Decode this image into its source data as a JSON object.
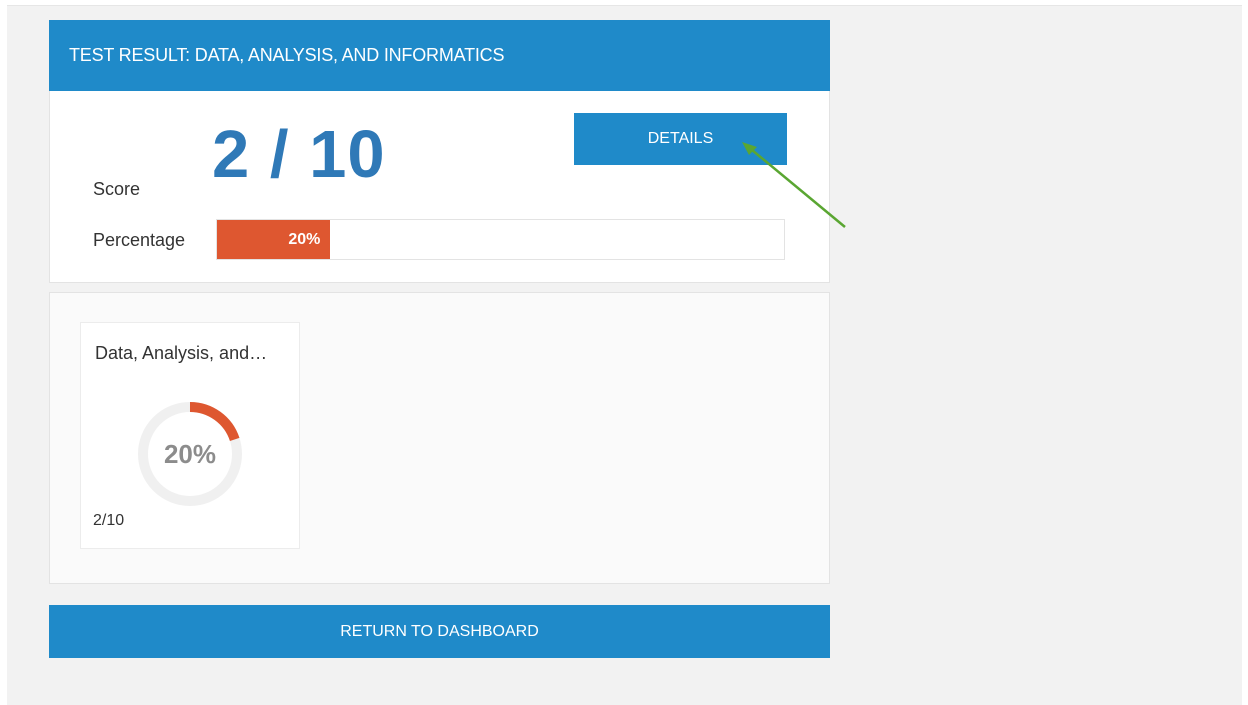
{
  "header": {
    "title": "TEST RESULT: DATA, ANALYSIS, AND INFORMATICS"
  },
  "score": {
    "label": "Score",
    "value": "2 / 10",
    "details_label": "DETAILS"
  },
  "percentage": {
    "label": "Percentage",
    "value_text": "20%",
    "value": 0.2
  },
  "categories": [
    {
      "title": "Data, Analysis, and…",
      "percent_text": "20%",
      "percent": 0.2,
      "score": "2/10"
    }
  ],
  "footer": {
    "return_label": "RETURN TO DASHBOARD"
  },
  "colors": {
    "primary": "#1f8ac9",
    "score_text": "#2f79b7",
    "progress_fill": "#de5730",
    "donut_track": "#f0f0f0",
    "annotation_arrow": "#5aa632"
  }
}
